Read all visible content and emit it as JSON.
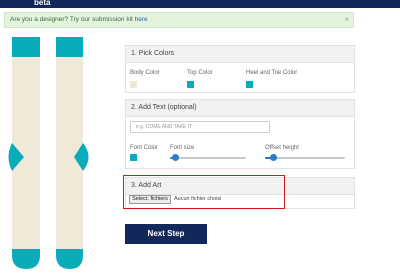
{
  "app": {
    "beta_label": "beta"
  },
  "notice": {
    "text": "Are you a designer? Try our submission kit",
    "link": "here",
    "close": "×"
  },
  "colors": {
    "sock_body": "#f1e9d8",
    "accent": "#0aacb9",
    "header_bar": "#13285a",
    "highlight_border": "#d2191c"
  },
  "pick_colors": {
    "title": "1. Pick Colors",
    "body_label": "Body Color",
    "top_label": "Top Color",
    "heel_toe_label": "Heel and Toe Color"
  },
  "add_text": {
    "title": "2. Add Text (optional)",
    "placeholder": "e.g. COME AND TAKE IT",
    "font_color_label": "Font Color",
    "font_size_label": "Font size",
    "offset_label": "Offset height",
    "font_size_value": 0.07,
    "offset_value": 0.1
  },
  "add_art": {
    "title": "3. Add Art",
    "file_button": "Select. fichiers",
    "file_status": "Aucun fichier choisi"
  },
  "next_step": "Next Step"
}
